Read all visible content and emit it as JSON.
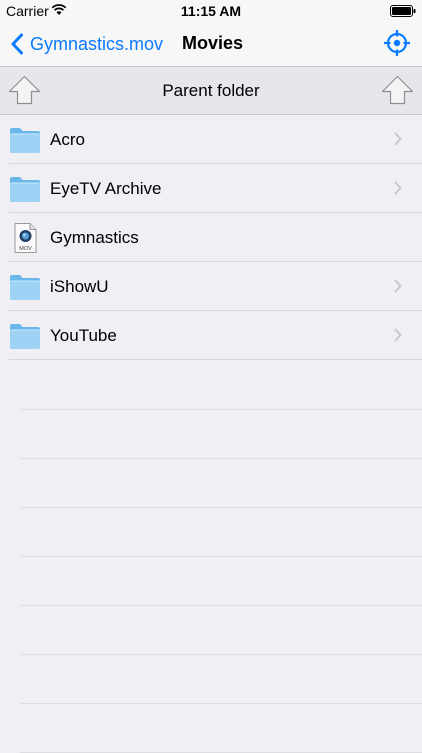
{
  "status_bar": {
    "carrier": "Carrier",
    "time": "11:15 AM"
  },
  "nav": {
    "back_label": "Gymnastics.mov",
    "title": "Movies",
    "accent_color": "#0a7bff"
  },
  "parent_row": {
    "label": "Parent folder"
  },
  "files": [
    {
      "name": "Acro",
      "type": "folder",
      "icon": "folder-icon",
      "has_chevron": true
    },
    {
      "name": "EyeTV Archive",
      "type": "folder",
      "icon": "folder-icon",
      "has_chevron": true
    },
    {
      "name": "Gymnastics",
      "type": "movie",
      "icon": "mov-file-icon",
      "icon_text": "MOV",
      "has_chevron": false
    },
    {
      "name": "iShowU",
      "type": "folder",
      "icon": "folder-icon",
      "has_chevron": true
    },
    {
      "name": "YouTube",
      "type": "folder",
      "icon": "folder-icon",
      "has_chevron": true
    }
  ]
}
